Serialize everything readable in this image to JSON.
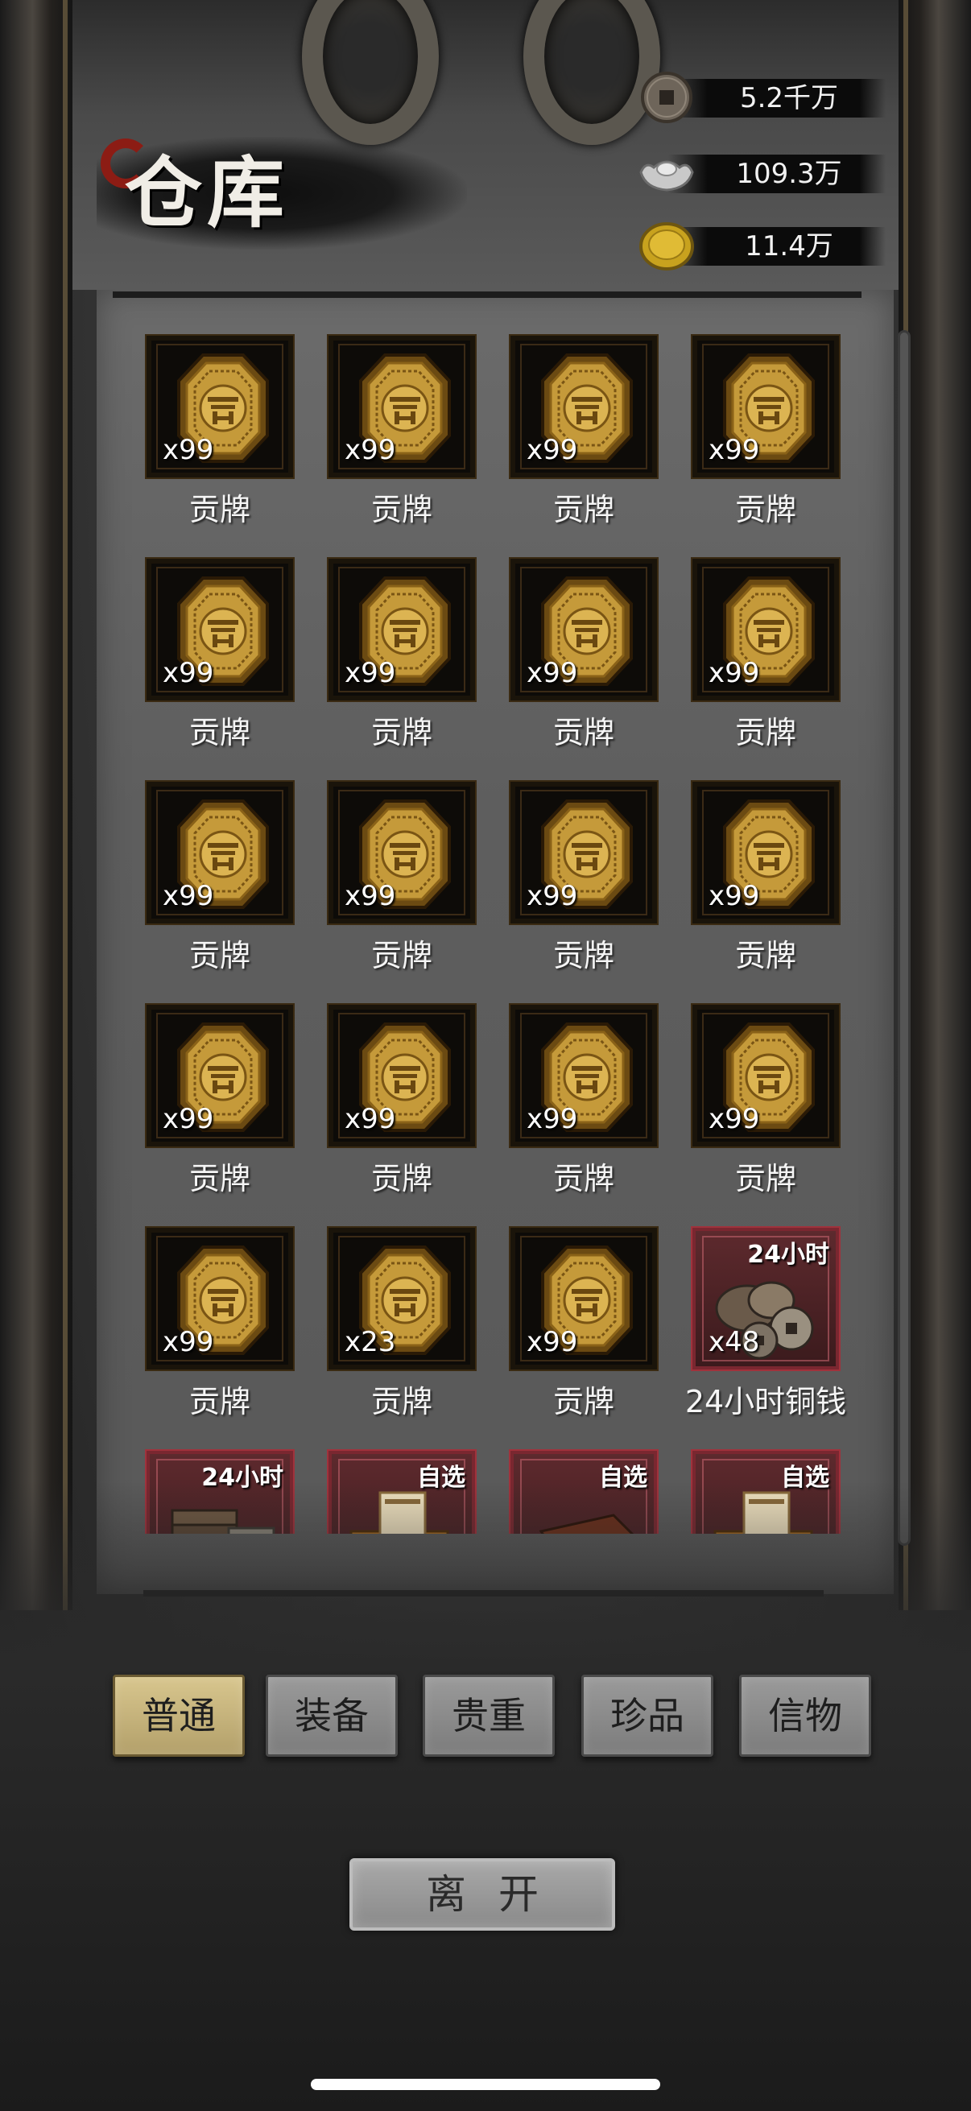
{
  "title": "仓库",
  "currencies": [
    {
      "icon": "copper-coin-icon",
      "value": "5.2千万"
    },
    {
      "icon": "silver-ingot-icon",
      "value": "109.3万"
    },
    {
      "icon": "gold-coin-icon",
      "value": "11.4万"
    }
  ],
  "items": [
    {
      "name": "贡牌",
      "qty": "x99",
      "icon": "tribute-token-icon"
    },
    {
      "name": "贡牌",
      "qty": "x99",
      "icon": "tribute-token-icon"
    },
    {
      "name": "贡牌",
      "qty": "x99",
      "icon": "tribute-token-icon"
    },
    {
      "name": "贡牌",
      "qty": "x99",
      "icon": "tribute-token-icon"
    },
    {
      "name": "贡牌",
      "qty": "x99",
      "icon": "tribute-token-icon"
    },
    {
      "name": "贡牌",
      "qty": "x99",
      "icon": "tribute-token-icon"
    },
    {
      "name": "贡牌",
      "qty": "x99",
      "icon": "tribute-token-icon"
    },
    {
      "name": "贡牌",
      "qty": "x99",
      "icon": "tribute-token-icon"
    },
    {
      "name": "贡牌",
      "qty": "x99",
      "icon": "tribute-token-icon"
    },
    {
      "name": "贡牌",
      "qty": "x99",
      "icon": "tribute-token-icon"
    },
    {
      "name": "贡牌",
      "qty": "x99",
      "icon": "tribute-token-icon"
    },
    {
      "name": "贡牌",
      "qty": "x99",
      "icon": "tribute-token-icon"
    },
    {
      "name": "贡牌",
      "qty": "x99",
      "icon": "tribute-token-icon"
    },
    {
      "name": "贡牌",
      "qty": "x99",
      "icon": "tribute-token-icon"
    },
    {
      "name": "贡牌",
      "qty": "x99",
      "icon": "tribute-token-icon"
    },
    {
      "name": "贡牌",
      "qty": "x99",
      "icon": "tribute-token-icon"
    },
    {
      "name": "贡牌",
      "qty": "x99",
      "icon": "tribute-token-icon"
    },
    {
      "name": "贡牌",
      "qty": "x23",
      "icon": "tribute-token-icon"
    },
    {
      "name": "贡牌",
      "qty": "x99",
      "icon": "tribute-token-icon"
    },
    {
      "name": "24小时铜钱",
      "qty": "x48",
      "badge": "24小时",
      "icon": "copper-coins-pile-icon"
    },
    {
      "name": "",
      "qty": "",
      "badge": "24小时",
      "icon": "treasure-chest-icon"
    },
    {
      "name": "",
      "qty": "",
      "badge": "自选",
      "icon": "scroll-chest-icon"
    },
    {
      "name": "",
      "qty": "",
      "badge": "自选",
      "icon": "fruit-chest-icon"
    },
    {
      "name": "",
      "qty": "",
      "badge": "自选",
      "icon": "scroll-chest-icon"
    }
  ],
  "tabs": [
    {
      "label": "普通",
      "active": true
    },
    {
      "label": "装备",
      "active": false
    },
    {
      "label": "贵重",
      "active": false
    },
    {
      "label": "珍品",
      "active": false
    },
    {
      "label": "信物",
      "active": false
    }
  ],
  "leave_label": "离开"
}
